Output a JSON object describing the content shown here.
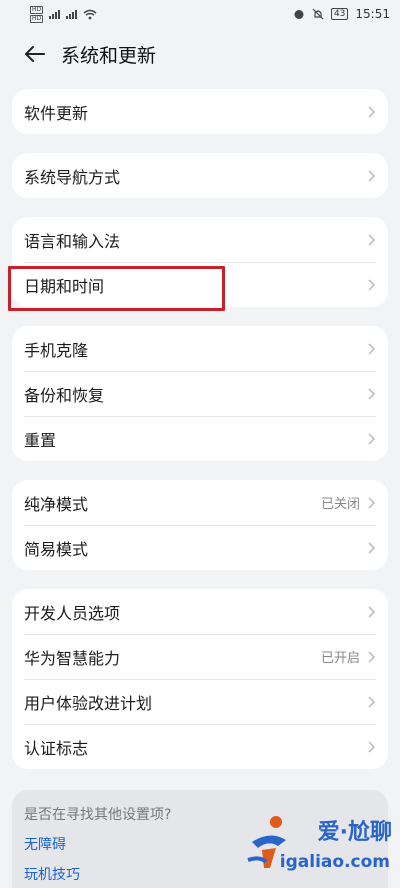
{
  "status": {
    "sim1": "HD",
    "sim2": "HD",
    "net1": "4G",
    "net2": "4G",
    "battery": "43",
    "time": "15:51"
  },
  "header": {
    "title": "系统和更新"
  },
  "groups": [
    {
      "rows": [
        {
          "label": "软件更新"
        }
      ]
    },
    {
      "rows": [
        {
          "label": "系统导航方式"
        }
      ]
    },
    {
      "rows": [
        {
          "label": "语言和输入法"
        },
        {
          "label": "日期和时间"
        }
      ]
    },
    {
      "rows": [
        {
          "label": "手机克隆"
        },
        {
          "label": "备份和恢复"
        },
        {
          "label": "重置"
        }
      ]
    },
    {
      "rows": [
        {
          "label": "纯净模式",
          "value": "已关闭"
        },
        {
          "label": "简易模式"
        }
      ]
    },
    {
      "rows": [
        {
          "label": "开发人员选项"
        },
        {
          "label": "华为智慧能力",
          "value": "已开启"
        },
        {
          "label": "用户体验改进计划"
        },
        {
          "label": "认证标志"
        }
      ]
    }
  ],
  "tips": {
    "question": "是否在寻找其他设置项?",
    "links": [
      "无障碍",
      "玩机技巧"
    ]
  },
  "watermark": {
    "brand": "爱·尬聊",
    "url": "igaliao.com"
  },
  "colors": {
    "highlight": "#c8202a",
    "link": "#1a62d6",
    "background": "#f1f3f5"
  }
}
